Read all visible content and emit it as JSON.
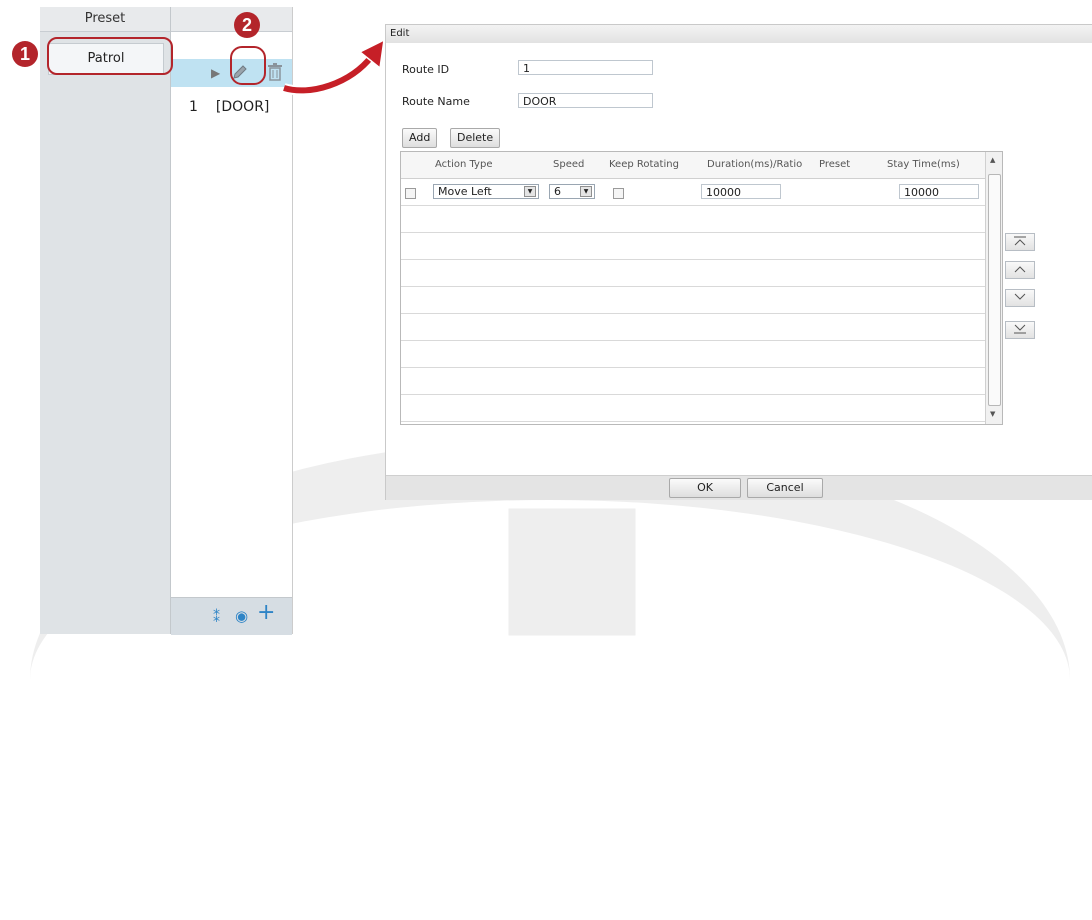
{
  "left_panel": {
    "col_header": "Preset",
    "tab_patrol": "Patrol",
    "route_num": "1",
    "route_name": "[DOOR]",
    "steps": [
      "1",
      "2"
    ],
    "icons": [
      "play-icon",
      "edit-pencil-icon",
      "delete-trash-icon",
      "route-add-icon",
      "record-icon",
      "plus-icon"
    ]
  },
  "dialog": {
    "title": "Edit",
    "route_id_label": "Route ID",
    "route_id_value": "1",
    "route_name_label": "Route Name",
    "route_name_value": "DOOR",
    "add_label": "Add",
    "delete_label": "Delete",
    "columns": [
      "Action Type",
      "Speed",
      "Keep Rotating",
      "Duration(ms)/Ratio",
      "Preset",
      "Stay Time(ms)"
    ],
    "row": {
      "action_type": "Move Left",
      "speed": "6",
      "duration": "10000",
      "stay_time": "10000"
    },
    "ok_label": "OK",
    "cancel_label": "Cancel",
    "move_buttons": [
      "move-top-icon",
      "move-up-icon",
      "move-down-icon",
      "move-bottom-icon"
    ]
  },
  "colors": {
    "highlight": "#b3252b",
    "selected_row": "#bfe2f2",
    "link_blue": "#2e84c6"
  }
}
